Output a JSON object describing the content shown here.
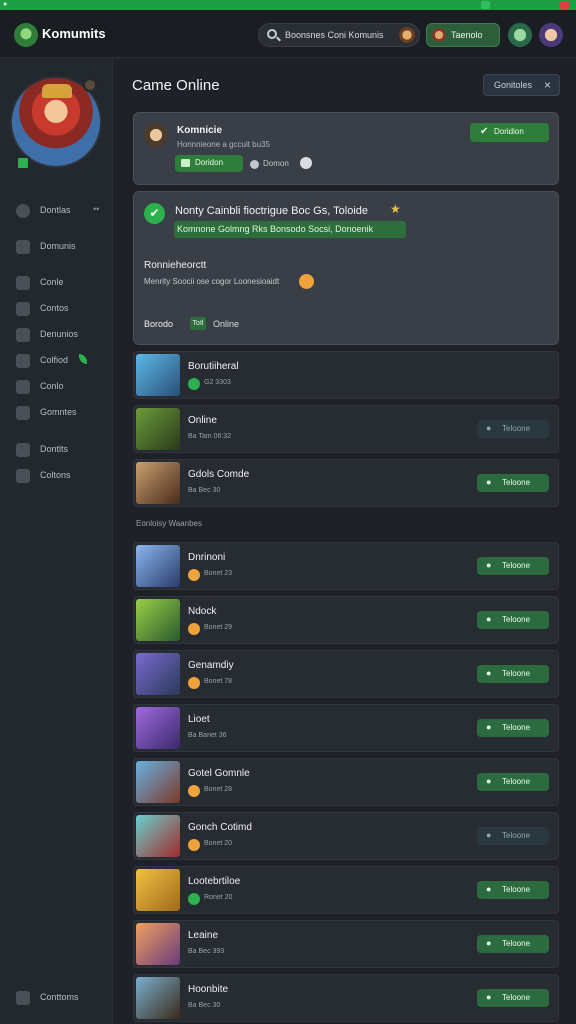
{
  "window": {
    "title_icon": "app-icon",
    "accent": "#1f9f45"
  },
  "topbar": {
    "app_name": "Komumits",
    "search_placeholder": "Boonsnes Coni Komunis",
    "pill_label": "Taenolo"
  },
  "sidebar": {
    "items": [
      {
        "label": "Dontlas",
        "icon": "play-icon",
        "caret": "••"
      },
      {
        "label": "Domunis",
        "icon": "puzzle-icon"
      },
      {
        "label": "Conle",
        "icon": "list-icon"
      },
      {
        "label": "Contos",
        "icon": "calendar-icon"
      },
      {
        "label": "Denunios",
        "icon": "chat-icon"
      },
      {
        "label": "Colfiod",
        "icon": "chart-icon"
      },
      {
        "label": "Conlo",
        "icon": "fire-icon"
      },
      {
        "label": "Gomntes",
        "icon": "flag-icon"
      },
      {
        "label": "Dontlts",
        "icon": "user-icon"
      },
      {
        "label": "Coltons",
        "icon": "folder-icon"
      }
    ],
    "footer_label": "Conttoms"
  },
  "main": {
    "title": "Came Online",
    "filter_label": "Gonitoles",
    "card1": {
      "name": "Komnicie",
      "sub": "Honnnieone a gccuit bu35",
      "tag": "Doridon",
      "meta": "Domon",
      "button": "Doridion"
    },
    "card2": {
      "title": "Nonty Cainbli fioctrigue Boc Gs, Toloide",
      "highlight": "Komnone Golmng Rks Bonsodo Socsi, Donoenik",
      "sub_title": "Ronnieheorctt",
      "sub_text": "Menrity Soocii ose cogor Loonesioaidt",
      "foot_a": "Borodo",
      "foot_tag": "Totl",
      "foot_b": "Online"
    },
    "section_label": "Eonloisy   Waanbes",
    "rows": [
      {
        "name": "Borutiiheral",
        "meta": "G2 3303",
        "btn": "",
        "emoji": "green",
        "muted": false
      },
      {
        "name": "Online",
        "meta": "Ba Tam 06:32",
        "btn": "Teloone",
        "emoji": "",
        "muted": true
      },
      {
        "name": "Gdols Comde",
        "meta": "Ba Bec 30",
        "btn": "Teloone",
        "emoji": "",
        "muted": false
      },
      {
        "name": "Dnrinoni",
        "meta": "Bonet 23",
        "btn": "Teloone",
        "emoji": "orange",
        "muted": false
      },
      {
        "name": "Ndock",
        "meta": "Bonet 29",
        "btn": "Teloone",
        "emoji": "orange",
        "muted": false
      },
      {
        "name": "Genamdiy",
        "meta": "Bonet 78",
        "btn": "Teloone",
        "emoji": "orange",
        "muted": false
      },
      {
        "name": "Lioet",
        "meta": "Ba Banet 36",
        "btn": "Teloone",
        "emoji": "",
        "muted": false
      },
      {
        "name": "Gotel Gomnle",
        "meta": "Bonet 28",
        "btn": "Teloone",
        "emoji": "orange",
        "muted": false
      },
      {
        "name": "Gonch Cotimd",
        "meta": "Bonet 20",
        "btn": "Teloone",
        "emoji": "orange",
        "muted": true
      },
      {
        "name": "Lootebrtiloe",
        "meta": "Ronet 20",
        "btn": "Teloone",
        "emoji": "green",
        "muted": false
      },
      {
        "name": "Leaine",
        "meta": "Ba Bec 393",
        "btn": "Teloone",
        "emoji": "",
        "muted": false
      },
      {
        "name": "Hoonbite",
        "meta": "Ba Bec 30",
        "btn": "Teloone",
        "emoji": "",
        "muted": false
      }
    ]
  }
}
